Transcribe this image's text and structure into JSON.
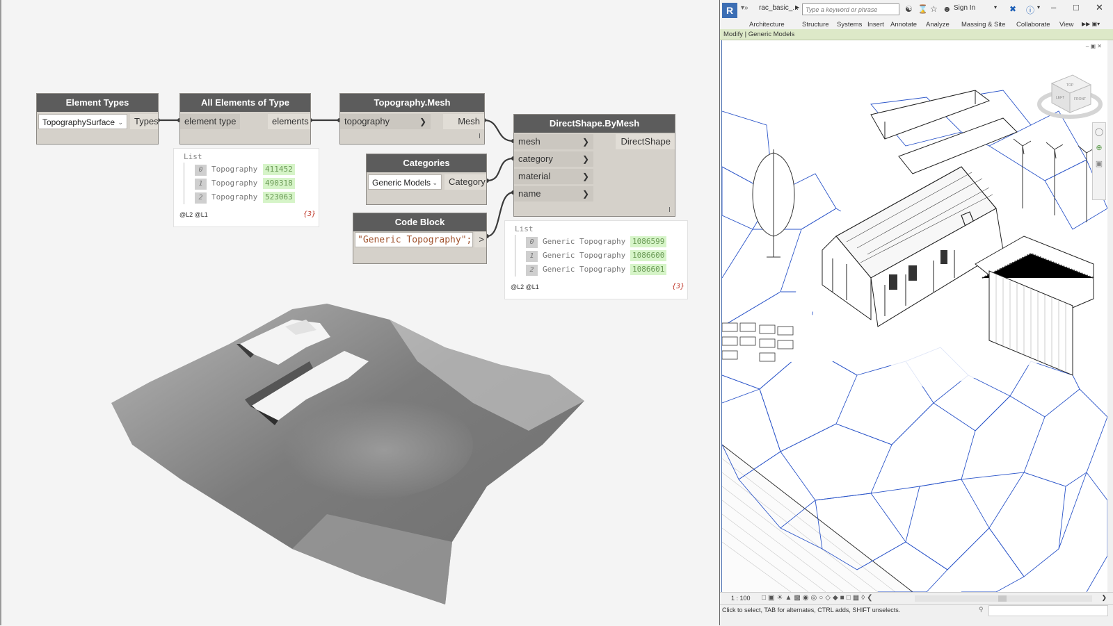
{
  "dynamo": {
    "nodes": {
      "element_types": {
        "title": "Element Types",
        "dropdown_value": "TopographySurface",
        "output": "Types"
      },
      "all_elements": {
        "title": "All Elements of Type",
        "input": "element type",
        "output": "elements"
      },
      "topography_mesh": {
        "title": "Topography.Mesh",
        "input": "topography",
        "output": "Mesh"
      },
      "categories": {
        "title": "Categories",
        "dropdown_value": "Generic Models",
        "output": "Category"
      },
      "code_block": {
        "title": "Code Block",
        "code": "\"Generic Topography\";",
        "output": ">"
      },
      "direct_shape": {
        "title": "DirectShape.ByMesh",
        "inputs": [
          "mesh",
          "category",
          "material",
          "name"
        ],
        "output": "DirectShape"
      }
    },
    "previews": {
      "elements": {
        "label": "List",
        "items": [
          {
            "index": "0",
            "name": "Topography",
            "id": "411452"
          },
          {
            "index": "1",
            "name": "Topography",
            "id": "490318"
          },
          {
            "index": "2",
            "name": "Topography",
            "id": "523063"
          }
        ],
        "levels": "@L2 @L1",
        "count": "{3}"
      },
      "direct_shape": {
        "label": "List",
        "items": [
          {
            "index": "0",
            "name": "Generic Topography",
            "id": "1086599"
          },
          {
            "index": "1",
            "name": "Generic Topography",
            "id": "1086600"
          },
          {
            "index": "2",
            "name": "Generic Topography",
            "id": "1086601"
          }
        ],
        "levels": "@L2 @L1",
        "count": "{3}"
      }
    }
  },
  "revit": {
    "file_name": "rac_basic_...",
    "search_placeholder": "Type a keyword or phrase",
    "sign_in": "Sign In",
    "tabs": [
      "Architecture",
      "Structure",
      "Systems",
      "Insert",
      "Annotate",
      "Analyze",
      "Massing & Site",
      "Collaborate",
      "View"
    ],
    "context_label": "Modify | Generic Models",
    "viewcube_faces": {
      "top": "TOP",
      "front": "FRONT",
      "left": "LEFT"
    },
    "scale": "1 : 100",
    "status_text": "Click to select, TAB for alternates, CTRL adds, SHIFT unselects."
  },
  "colors": {
    "node_header": "#5c5c5c",
    "node_body": "#d5d1ca",
    "wireframe": "#2b55c9",
    "value_highlight": "#d6f4c8",
    "context_bar": "#dde9c8"
  },
  "icons": [
    "revit-logo-icon",
    "binoculars-icon",
    "star-icon",
    "user-icon",
    "help-icon",
    "minimize-icon",
    "maximize-icon",
    "close-icon",
    "viewcube-icon",
    "dropdown-chevron-icon",
    "port-chevron-icon"
  ]
}
